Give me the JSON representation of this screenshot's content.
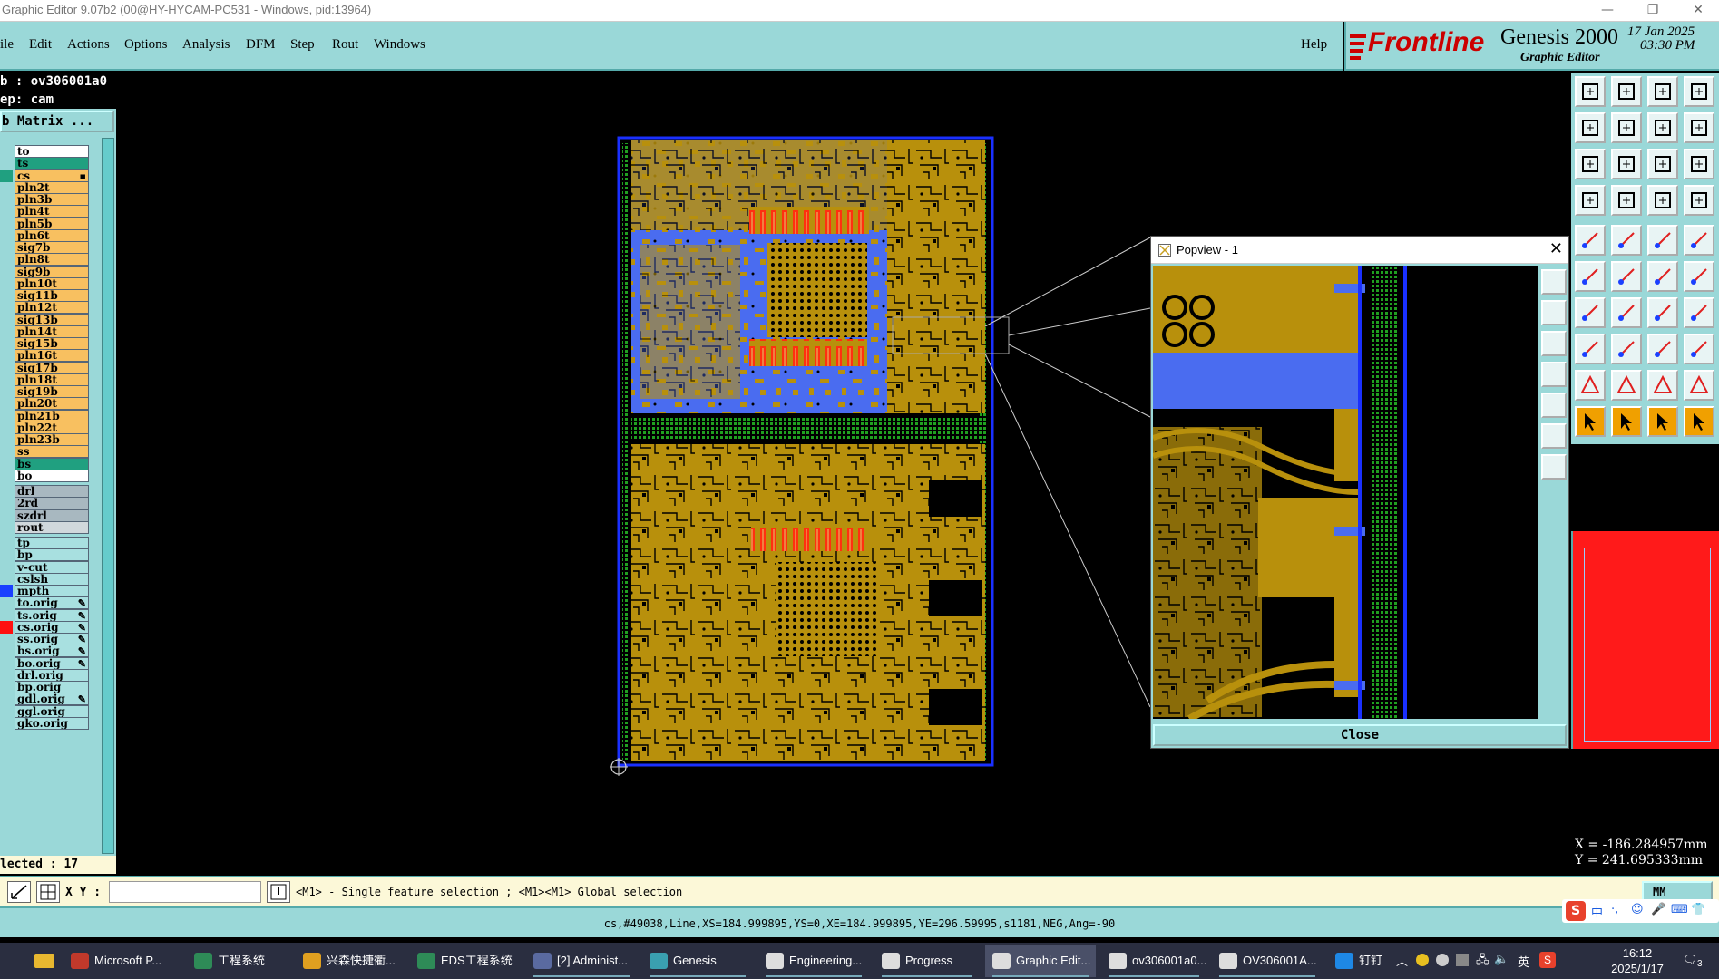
{
  "window": {
    "title": "Graphic Editor 9.07b2 (00@HY-HYCAM-PC531 - Windows, pid:13964)"
  },
  "menu": {
    "items": [
      "ile",
      "Edit",
      "Actions",
      "Options",
      "Analysis",
      "DFM",
      "Step",
      "Rout",
      "Windows"
    ],
    "help": "Help"
  },
  "brand": {
    "frontline": "Frontline",
    "genesis": "Genesis 2000",
    "editor": "Graphic Editor",
    "date": "17 Jan 2025",
    "time": "03:30 PM"
  },
  "job": {
    "job_label": "b : ov306001a0",
    "step_label": "ep: cam",
    "matrix_button": "b Matrix ..."
  },
  "layers": [
    {
      "name": "to",
      "color": "#ffffff",
      "ind": ""
    },
    {
      "name": "ts",
      "color": "#20a080",
      "ind": ""
    },
    {
      "name": "cs",
      "color": "#f8c060",
      "ind": "#20a080",
      "mark": "▪"
    },
    {
      "name": "pln2t",
      "color": "#f8c060",
      "ind": ""
    },
    {
      "name": "pln3b",
      "color": "#f8c060",
      "ind": ""
    },
    {
      "name": "pln4t",
      "color": "#f8c060",
      "ind": ""
    },
    {
      "name": "pln5b",
      "color": "#f8c060",
      "ind": ""
    },
    {
      "name": "pln6t",
      "color": "#f8c060",
      "ind": ""
    },
    {
      "name": "sig7b",
      "color": "#f8c060",
      "ind": ""
    },
    {
      "name": "pln8t",
      "color": "#f8c060",
      "ind": ""
    },
    {
      "name": "sig9b",
      "color": "#f8c060",
      "ind": ""
    },
    {
      "name": "pln10t",
      "color": "#f8c060",
      "ind": ""
    },
    {
      "name": "sig11b",
      "color": "#f8c060",
      "ind": ""
    },
    {
      "name": "pln12t",
      "color": "#f8c060",
      "ind": ""
    },
    {
      "name": "sig13b",
      "color": "#f8c060",
      "ind": ""
    },
    {
      "name": "pln14t",
      "color": "#f8c060",
      "ind": ""
    },
    {
      "name": "sig15b",
      "color": "#f8c060",
      "ind": ""
    },
    {
      "name": "pln16t",
      "color": "#f8c060",
      "ind": ""
    },
    {
      "name": "sig17b",
      "color": "#f8c060",
      "ind": ""
    },
    {
      "name": "pln18t",
      "color": "#f8c060",
      "ind": ""
    },
    {
      "name": "sig19b",
      "color": "#f8c060",
      "ind": ""
    },
    {
      "name": "pln20t",
      "color": "#f8c060",
      "ind": ""
    },
    {
      "name": "pln21b",
      "color": "#f8c060",
      "ind": ""
    },
    {
      "name": "pln22t",
      "color": "#f8c060",
      "ind": ""
    },
    {
      "name": "pln23b",
      "color": "#f8c060",
      "ind": ""
    },
    {
      "name": "ss",
      "color": "#f8c060",
      "ind": ""
    },
    {
      "name": "bs",
      "color": "#20a080",
      "ind": ""
    },
    {
      "name": "bo",
      "color": "#ffffff",
      "ind": ""
    },
    {
      "name": "drl",
      "color": "#a8b8c0",
      "ind": ""
    },
    {
      "name": "2rd",
      "color": "#a8b8c0",
      "ind": ""
    },
    {
      "name": "szdrl",
      "color": "#a8b8c0",
      "ind": ""
    },
    {
      "name": "rout",
      "color": "#d0d8dc",
      "ind": ""
    },
    {
      "name": "tp",
      "color": "#a8e0e0",
      "ind": ""
    },
    {
      "name": "bp",
      "color": "#a8e0e0",
      "ind": ""
    },
    {
      "name": "v-cut",
      "color": "#a8e0e0",
      "ind": ""
    },
    {
      "name": "cslsh",
      "color": "#a8e0e0",
      "ind": ""
    },
    {
      "name": "mpth",
      "color": "#a8e0e0",
      "ind": "#1a40ff"
    },
    {
      "name": "to.orig",
      "color": "#a8e0e0",
      "ind": "",
      "mark": "✎"
    },
    {
      "name": "ts.orig",
      "color": "#a8e0e0",
      "ind": "",
      "mark": "✎"
    },
    {
      "name": "cs.orig",
      "color": "#a8e0e0",
      "ind": "#ff1010",
      "mark": "✎"
    },
    {
      "name": "ss.orig",
      "color": "#a8e0e0",
      "ind": "",
      "mark": "✎"
    },
    {
      "name": "bs.orig",
      "color": "#a8e0e0",
      "ind": "",
      "mark": "✎"
    },
    {
      "name": "bo.orig",
      "color": "#a8e0e0",
      "ind": "",
      "mark": "✎"
    },
    {
      "name": "drl.orig",
      "color": "#a8e0e0",
      "ind": ""
    },
    {
      "name": "bp.orig",
      "color": "#a8e0e0",
      "ind": ""
    },
    {
      "name": "gdl.orig",
      "color": "#a8e0e0",
      "ind": "",
      "mark": "✎"
    },
    {
      "name": "ggl.orig",
      "color": "#a8e0e0",
      "ind": ""
    },
    {
      "name": "gko.orig",
      "color": "#a8e0e0",
      "ind": ""
    }
  ],
  "selected_count": "lected : 17",
  "popview": {
    "title": "Popview - 1",
    "close_label": "Close"
  },
  "coords": {
    "x": "X = -186.284957mm",
    "y": "Y = 241.695333mm"
  },
  "command": {
    "xy_label": "X Y :",
    "message": "<M1> - Single feature selection ; <M1><M1> Global selection",
    "units": "MM"
  },
  "feature_info": "cs,#49038,Line,XS=184.999895,YS=0,XE=184.999895,YE=296.59995,s1181,NEG,Ang=-90",
  "taskbar": {
    "items": [
      {
        "label": "Microsoft P...",
        "icon": "#c0392b"
      },
      {
        "label": "工程系统",
        "icon": "#2e8b57"
      },
      {
        "label": "兴森快捷衢...",
        "icon": "#e0a020"
      },
      {
        "label": "EDS工程系统",
        "icon": "#2e8b57"
      },
      {
        "label": "[2] Administ...",
        "icon": "#5a6aa0"
      },
      {
        "label": "Genesis",
        "icon": "#3aa0b0"
      },
      {
        "label": "Engineering...",
        "icon": "#dddddd"
      },
      {
        "label": "Progress",
        "icon": "#dddddd"
      },
      {
        "label": "Graphic Edit...",
        "icon": "#dddddd"
      },
      {
        "label": "ov306001a0...",
        "icon": "#dddddd"
      },
      {
        "label": "OV306001A...",
        "icon": "#dddddd"
      },
      {
        "label": "钉钉",
        "icon": "#1e88e5"
      }
    ],
    "clock_time": "16:12",
    "clock_date": "2025/1/17",
    "ime": "英",
    "notify_count": "3"
  },
  "colors": {
    "panel": "#9ad8d8",
    "copper": "#b8900c",
    "plane_blue": "#4a6cf0",
    "pad_red": "#ff3010",
    "via_green": "#20a020"
  }
}
